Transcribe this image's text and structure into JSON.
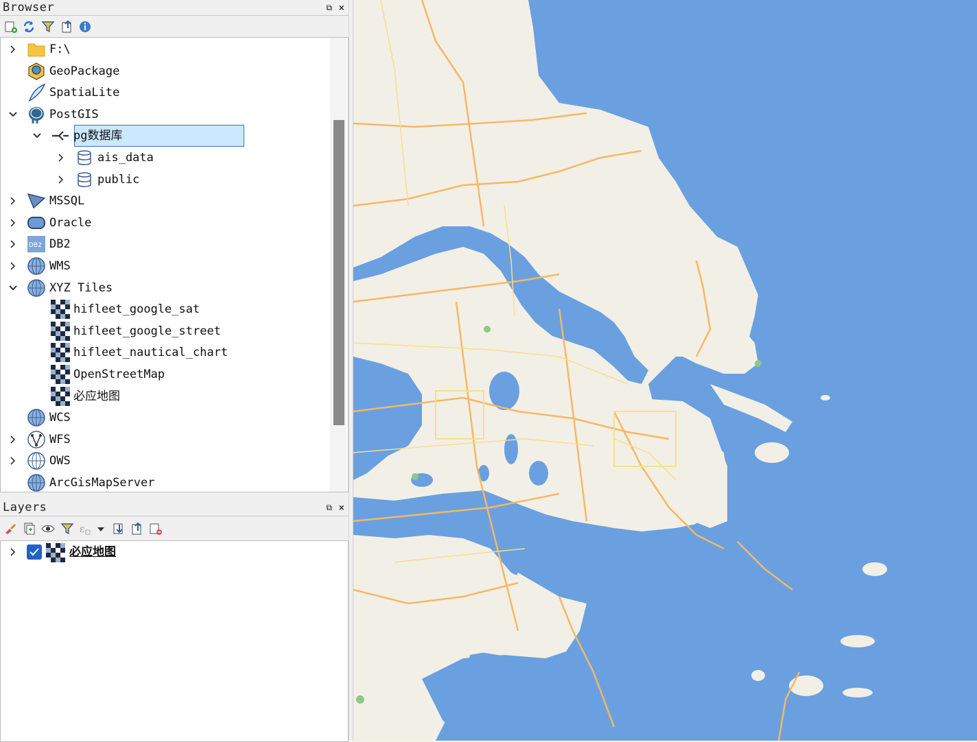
{
  "browser": {
    "title": "Browser",
    "float_glyph": "⧉",
    "close_glyph": "×",
    "toolbar": [
      "add-layer-icon",
      "refresh-icon",
      "filter-icon",
      "collapse-all-icon",
      "info-icon"
    ],
    "items": [
      {
        "label": "F:\\",
        "icon": "folder-icon",
        "expander": "collapsed"
      },
      {
        "label": "GeoPackage",
        "icon": "geopackage-icon",
        "expander": "none"
      },
      {
        "label": "SpatiaLite",
        "icon": "spatialite-icon",
        "expander": "none"
      },
      {
        "label": "PostGIS",
        "icon": "postgis-elephant-icon",
        "expander": "expanded"
      },
      {
        "label": "pg数据库",
        "icon": "connection-icon",
        "expander": "expanded",
        "selected": true
      },
      {
        "label": "ais_data",
        "icon": "schema-icon",
        "expander": "collapsed"
      },
      {
        "label": "public",
        "icon": "schema-icon",
        "expander": "collapsed"
      },
      {
        "label": "MSSQL",
        "icon": "mssql-icon",
        "expander": "collapsed"
      },
      {
        "label": "Oracle",
        "icon": "oracle-icon",
        "expander": "collapsed"
      },
      {
        "label": "DB2",
        "icon": "db2-icon",
        "expander": "collapsed",
        "icon_text": "DB2"
      },
      {
        "label": "WMS",
        "icon": "globe-icon",
        "expander": "collapsed"
      },
      {
        "label": "XYZ Tiles",
        "icon": "globe-icon",
        "expander": "expanded"
      },
      {
        "label": "hifleet_google_sat",
        "icon": "xyz-tile-icon",
        "expander": "none"
      },
      {
        "label": "hifleet_google_street",
        "icon": "xyz-tile-icon",
        "expander": "none"
      },
      {
        "label": "hifleet_nautical_chart",
        "icon": "xyz-tile-icon",
        "expander": "none"
      },
      {
        "label": "OpenStreetMap",
        "icon": "xyz-tile-icon",
        "expander": "none"
      },
      {
        "label": "必应地图",
        "icon": "xyz-tile-icon",
        "expander": "none"
      },
      {
        "label": "WCS",
        "icon": "globe-icon",
        "expander": "none"
      },
      {
        "label": "WFS",
        "icon": "wfs-icon",
        "expander": "collapsed"
      },
      {
        "label": "OWS",
        "icon": "globe-outline-icon",
        "expander": "collapsed"
      },
      {
        "label": "ArcGisMapServer",
        "icon": "globe-icon",
        "expander": "none"
      }
    ]
  },
  "layers": {
    "title": "Layers",
    "float_glyph": "⧉",
    "close_glyph": "×",
    "toolbar": [
      "style-brush-icon",
      "add-group-icon",
      "visibility-icon",
      "filter-legend-icon",
      "expression-filter-icon",
      "dropdown-icon",
      "expand-all-icon",
      "collapse-all-icon",
      "remove-layer-icon"
    ],
    "items": [
      {
        "label": "必应地图",
        "checked": true
      }
    ]
  },
  "map": {
    "water_color": "#6aa0e0",
    "land_color": "#f2efe6",
    "road_color": "#f7b764",
    "minor_road_color": "#f6e08a",
    "park_color": "#8fc88a"
  }
}
